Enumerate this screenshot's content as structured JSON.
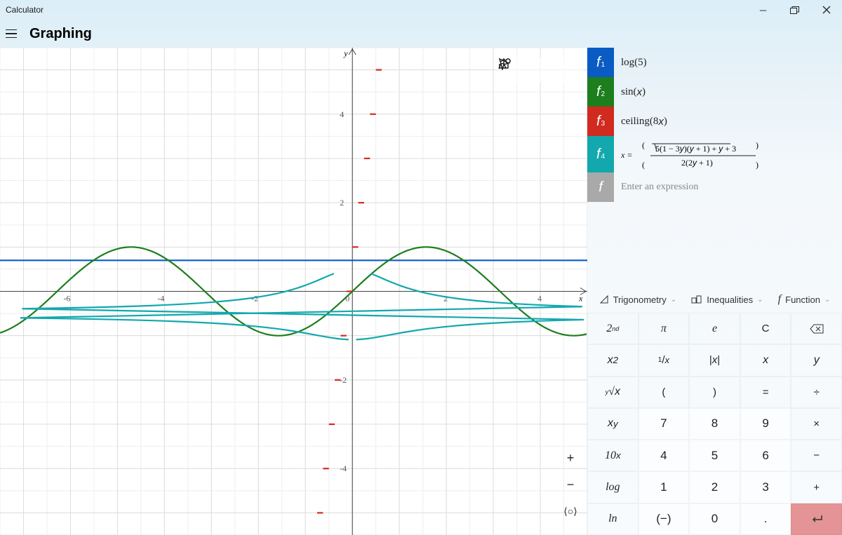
{
  "window": {
    "title": "Calculator",
    "mode": "Graphing"
  },
  "graph_tools": {
    "trace": "trace",
    "share": "share",
    "settings": "graph-settings"
  },
  "zoom_tools": {
    "in": "+",
    "out": "−",
    "reset": "[○]"
  },
  "functions": [
    {
      "label": "f",
      "sub": "1",
      "color": "#0a5bc4",
      "expr": "log(5)"
    },
    {
      "label": "f",
      "sub": "2",
      "color": "#1c7e1c",
      "expr": "sin(x)"
    },
    {
      "label": "f",
      "sub": "3",
      "color": "#d12a1f",
      "expr": "ceiling(8x)"
    },
    {
      "label": "f",
      "sub": "4",
      "color": "#12a8ae",
      "expr": "x = ( √(5(1 − 3y)(y + 1) + y + 3) / 2(2y + 1) )"
    }
  ],
  "entry_placeholder": "Enter an expression",
  "categories": {
    "trig": "Trigonometry",
    "ineq": "Inequalities",
    "func": "Function"
  },
  "keys": {
    "r0": [
      "2nd",
      "π",
      "e",
      "C",
      "⌫"
    ],
    "r1": [
      "x²",
      "1/x",
      "|x|",
      "x",
      "y"
    ],
    "r2": [
      "ⁿ√x",
      "(",
      ")",
      "=",
      "÷"
    ],
    "r3": [
      "xʸ",
      "7",
      "8",
      "9",
      "×"
    ],
    "r4": [
      "10ˣ",
      "4",
      "5",
      "6",
      "−"
    ],
    "r5": [
      "log",
      "1",
      "2",
      "3",
      "+"
    ],
    "r6": [
      "ln",
      "(−)",
      "0",
      ".",
      "↵"
    ]
  },
  "chart_data": {
    "type": "line",
    "xlim": [
      -7.5,
      5.0
    ],
    "ylim": [
      -5.5,
      5.5
    ],
    "xticks": [
      -6,
      -4,
      -2,
      0,
      2,
      4
    ],
    "yticks": [
      -4,
      -2,
      0,
      2,
      4
    ],
    "series": [
      {
        "name": "log(5)",
        "color": "#0a5bc4",
        "const_y": 0.699
      },
      {
        "name": "sin(x)",
        "color": "#1c7e1c"
      },
      {
        "name": "ceiling(8x)",
        "color": "#d12a1f"
      },
      {
        "name": "f4-implicit",
        "color": "#12a8ae"
      }
    ]
  }
}
